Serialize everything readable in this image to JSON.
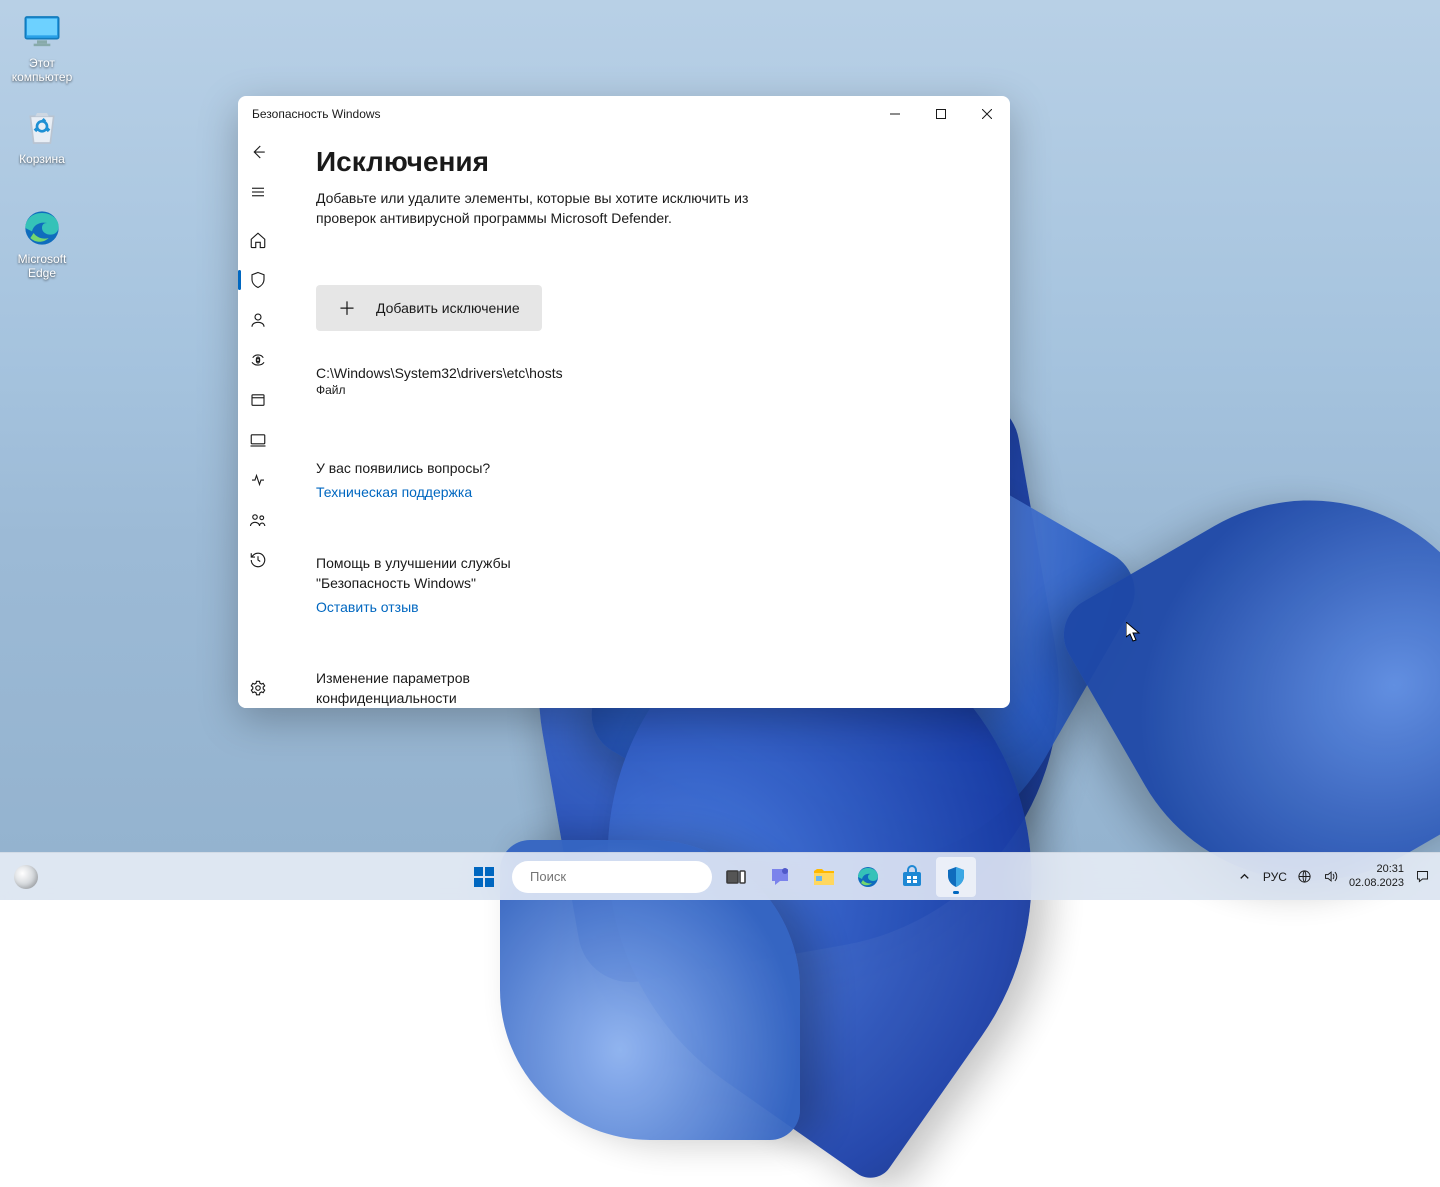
{
  "desktop_icons": {
    "this_pc": "Этот\nкомпьютер",
    "recycle": "Корзина",
    "edge": "Microsoft\nEdge"
  },
  "window": {
    "title": "Безопасность Windows",
    "page_title": "Исключения",
    "page_sub": "Добавьте или удалите элементы, которые вы хотите исключить из проверок антивирусной программы Microsoft Defender.",
    "add_button": "Добавить исключение",
    "exclusion": {
      "path": "C:\\Windows\\System32\\drivers\\etc\\hosts",
      "type": "Файл"
    },
    "help_heading": "У вас появились вопросы?",
    "help_link": "Техническая поддержка",
    "improve_heading": "Помощь в улучшении службы \"Безопасность Windows\"",
    "improve_link": "Оставить отзыв",
    "privacy_heading": "Изменение параметров конфиденциальности"
  },
  "taskbar": {
    "search_placeholder": "Поиск",
    "lang": "РУС",
    "time": "20:31",
    "date": "02.08.2023"
  }
}
